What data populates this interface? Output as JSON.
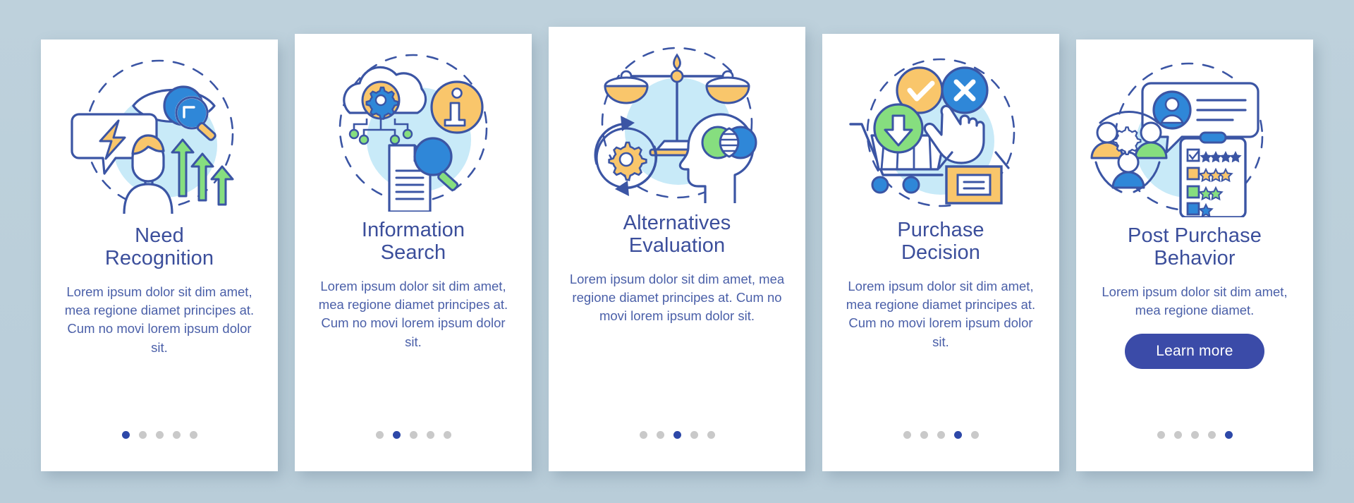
{
  "background_color": "#bed1dc",
  "theme": {
    "title_color": "#3b4e9b",
    "body_color": "#4a5fa8",
    "dot_active_color": "#2d48a8",
    "dot_inactive_color": "#c9c9c9",
    "button_color": "#3b4ba8",
    "card_color": "#ffffff",
    "accent_blue": "#2f87d8",
    "accent_light_blue": "#bfe5f5",
    "accent_yellow": "#f9c66b",
    "accent_green": "#86de7f",
    "outline_blue": "#3b55a4"
  },
  "total_steps": 5,
  "cards": [
    {
      "id": "need-recognition",
      "title": "Need\nRecognition",
      "title_lines": [
        "Need",
        "Recognition"
      ],
      "body": "Lorem ipsum dolor sit dim amet, mea regione diamet principes at. Cum no movi lorem ipsum dolor sit.",
      "active_dot": 1,
      "icon_name": "eye-magnifier-person-idea-icon",
      "has_button": false
    },
    {
      "id": "information-search",
      "title": "Information\nSearch",
      "title_lines": [
        "Information",
        "Search"
      ],
      "body": "Lorem ipsum dolor sit dim amet, mea regione diamet principes at. Cum no movi lorem ipsum dolor sit.",
      "active_dot": 2,
      "icon_name": "cloud-gear-info-document-search-icon",
      "has_button": false
    },
    {
      "id": "alternatives-evaluation",
      "title": "Alternatives\nEvaluation",
      "title_lines": [
        "Alternatives",
        "Evaluation"
      ],
      "body": "Lorem ipsum dolor sit dim amet, mea regione diamet principes at. Cum no movi lorem ipsum dolor sit.",
      "active_dot": 3,
      "icon_name": "balance-scale-gear-head-icon",
      "has_button": false
    },
    {
      "id": "purchase-decision",
      "title": "Purchase\nDecision",
      "title_lines": [
        "Purchase",
        "Decision"
      ],
      "body": "Lorem ipsum dolor sit dim amet, mea regione diamet principes at. Cum no movi lorem ipsum dolor sit.",
      "active_dot": 4,
      "icon_name": "shopping-cart-check-cross-box-icon",
      "has_button": false
    },
    {
      "id": "post-purchase-behavior",
      "title": "Post Purchase\nBehavior",
      "title_lines": [
        "Post Purchase",
        "Behavior"
      ],
      "body": "Lorem ipsum dolor sit dim amet, mea regione diamet.",
      "active_dot": 5,
      "icon_name": "users-review-clipboard-rating-icon",
      "has_button": true,
      "button_label": "Learn more"
    }
  ]
}
